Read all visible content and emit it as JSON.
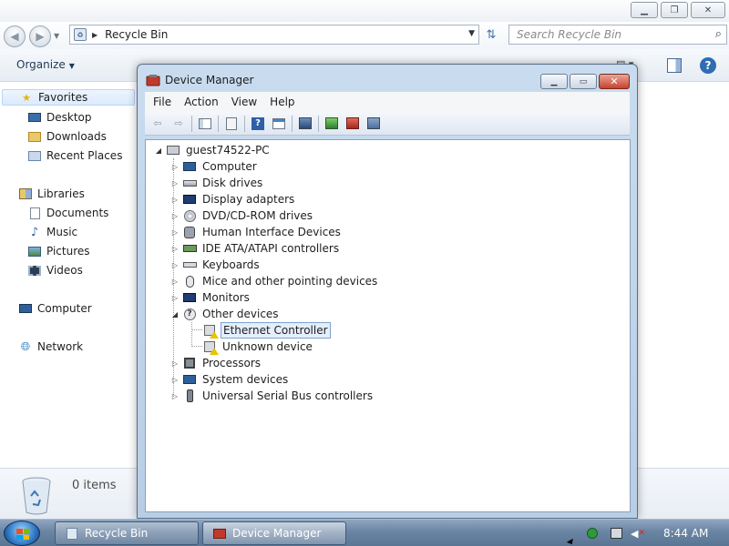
{
  "explorer": {
    "address": {
      "location": "Recycle Bin"
    },
    "search": {
      "placeholder": "Search Recycle Bin"
    },
    "toolbar": {
      "organize_label": "Organize"
    },
    "navigation": {
      "favorites_label": "Favorites",
      "favorites": [
        "Desktop",
        "Downloads",
        "Recent Places"
      ],
      "libraries_label": "Libraries",
      "libraries": [
        "Documents",
        "Music",
        "Pictures",
        "Videos"
      ],
      "computer_label": "Computer",
      "network_label": "Network"
    },
    "details": {
      "items_count": "0 items"
    }
  },
  "device_manager": {
    "title": "Device Manager",
    "menu": {
      "file": "File",
      "action": "Action",
      "view": "View",
      "help": "Help"
    },
    "root": "guest74522-PC",
    "categories": [
      "Computer",
      "Disk drives",
      "Display adapters",
      "DVD/CD-ROM drives",
      "Human Interface Devices",
      "IDE ATA/ATAPI controllers",
      "Keyboards",
      "Mice and other pointing devices",
      "Monitors",
      "Other devices",
      "Processors",
      "System devices",
      "Universal Serial Bus controllers"
    ],
    "other_devices": [
      "Ethernet Controller",
      "Unknown device"
    ]
  },
  "taskbar": {
    "buttons": [
      "Recycle Bin",
      "Device Manager"
    ],
    "clock": "8:44 AM"
  },
  "colors": {
    "accent": "#2e6db4",
    "warning": "#e8c400",
    "close_red": "#c7422d",
    "taskbar": "#6a84a3"
  }
}
